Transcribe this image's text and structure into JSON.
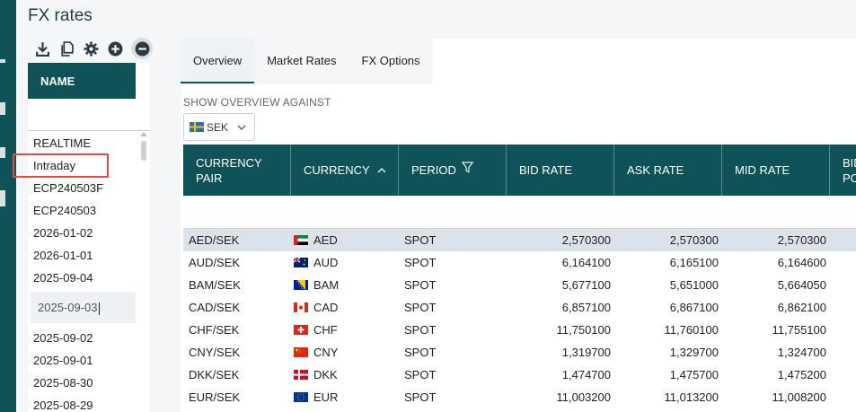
{
  "page": {
    "title": "FX rates"
  },
  "toolbar": {
    "buttons": [
      "download-icon",
      "copy-icon",
      "gear-icon",
      "add-circle-icon",
      "remove-circle-icon"
    ]
  },
  "name_panel": {
    "header": "NAME",
    "filter_value": "",
    "items": [
      "REALTIME",
      "Intraday",
      "ECP240503F",
      "ECP240503",
      "2026-01-02",
      "2026-01-01",
      "2025-09-04",
      "2025-09-03",
      "2025-09-02",
      "2025-09-01",
      "2025-08-30",
      "2025-08-29"
    ],
    "highlighted_item": "Intraday",
    "editing_item": "2025-09-03"
  },
  "tabs": [
    {
      "label": "Overview",
      "active": true
    },
    {
      "label": "Market Rates",
      "active": false
    },
    {
      "label": "FX Options",
      "active": false
    }
  ],
  "overview": {
    "against_label": "SHOW OVERVIEW AGAINST",
    "against_currency": "SEK",
    "against_flag": "se"
  },
  "grid": {
    "columns": [
      {
        "label": "CURRENCY PAIR"
      },
      {
        "label": "CURRENCY",
        "sort": "asc"
      },
      {
        "label": "PERIOD",
        "filter": true
      },
      {
        "label": "BID RATE"
      },
      {
        "label": "ASK RATE"
      },
      {
        "label": "MID RATE"
      },
      {
        "label": "BID PO"
      }
    ],
    "rows": [
      {
        "pair": "AED/SEK",
        "currency": "AED",
        "flag": "ae",
        "period": "SPOT",
        "bid": "2,570300",
        "ask": "2,570300",
        "mid": "2,570300",
        "selected": true
      },
      {
        "pair": "AUD/SEK",
        "currency": "AUD",
        "flag": "au",
        "period": "SPOT",
        "bid": "6,164100",
        "ask": "6,165100",
        "mid": "6,164600",
        "selected": false
      },
      {
        "pair": "BAM/SEK",
        "currency": "BAM",
        "flag": "ba",
        "period": "SPOT",
        "bid": "5,677100",
        "ask": "5,651000",
        "mid": "5,664050",
        "selected": false
      },
      {
        "pair": "CAD/SEK",
        "currency": "CAD",
        "flag": "ca",
        "period": "SPOT",
        "bid": "6,857100",
        "ask": "6,867100",
        "mid": "6,862100",
        "selected": false
      },
      {
        "pair": "CHF/SEK",
        "currency": "CHF",
        "flag": "ch",
        "period": "SPOT",
        "bid": "11,750100",
        "ask": "11,760100",
        "mid": "11,755100",
        "selected": false
      },
      {
        "pair": "CNY/SEK",
        "currency": "CNY",
        "flag": "cn",
        "period": "SPOT",
        "bid": "1,319700",
        "ask": "1,329700",
        "mid": "1,324700",
        "selected": false
      },
      {
        "pair": "DKK/SEK",
        "currency": "DKK",
        "flag": "dk",
        "period": "SPOT",
        "bid": "1,474700",
        "ask": "1,475700",
        "mid": "1,475200",
        "selected": false
      },
      {
        "pair": "EUR/SEK",
        "currency": "EUR",
        "flag": "eu",
        "period": "SPOT",
        "bid": "11,003200",
        "ask": "11,013200",
        "mid": "11,008200",
        "selected": false
      }
    ]
  },
  "colors": {
    "brand": "#0f5257",
    "highlight": "#e24a4a",
    "selected_row": "#dce3e8"
  }
}
